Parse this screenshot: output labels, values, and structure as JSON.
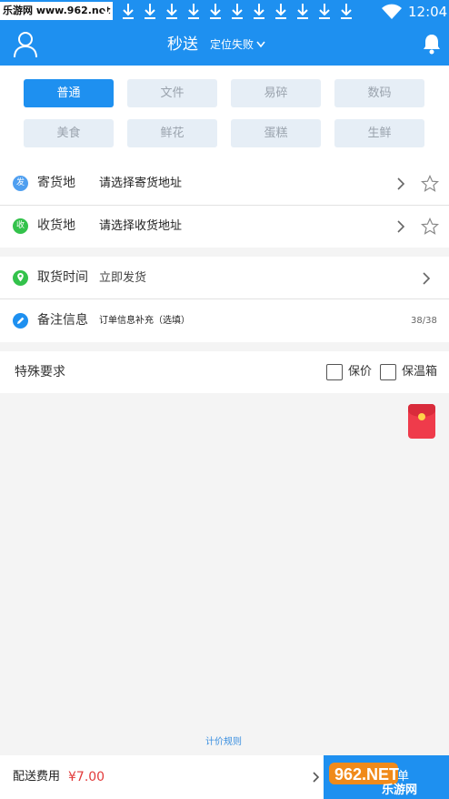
{
  "statusbar": {
    "watermark": "乐游网 www.962.net",
    "time": "12:04",
    "download_icon_count": 12
  },
  "appbar": {
    "title": "秒送",
    "location": "定位失败"
  },
  "categories": [
    "普通",
    "文件",
    "易碎",
    "数码",
    "美食",
    "鲜花",
    "蛋糕",
    "生鲜"
  ],
  "selected_category": "普通",
  "address": {
    "send": {
      "badge": "发",
      "label": "寄货地",
      "value": "请选择寄货地址"
    },
    "receive": {
      "badge": "收",
      "label": "收货地",
      "value": "请选择收货地址"
    }
  },
  "pickup": {
    "label": "取货时间",
    "value": "立即发货"
  },
  "note": {
    "label": "备注信息",
    "value": "订单信息补充（选填）",
    "counter": "38/38"
  },
  "special": {
    "title": "特殊要求",
    "options": [
      "保价",
      "保温箱"
    ]
  },
  "pricing_rule": "计价规则",
  "footer": {
    "fee_label": "配送费用",
    "fee_value": "¥7.00",
    "submit": "立即下单"
  },
  "colors": {
    "primary": "#1e90f0",
    "price": "#e23a3a",
    "green": "#33c24b"
  }
}
